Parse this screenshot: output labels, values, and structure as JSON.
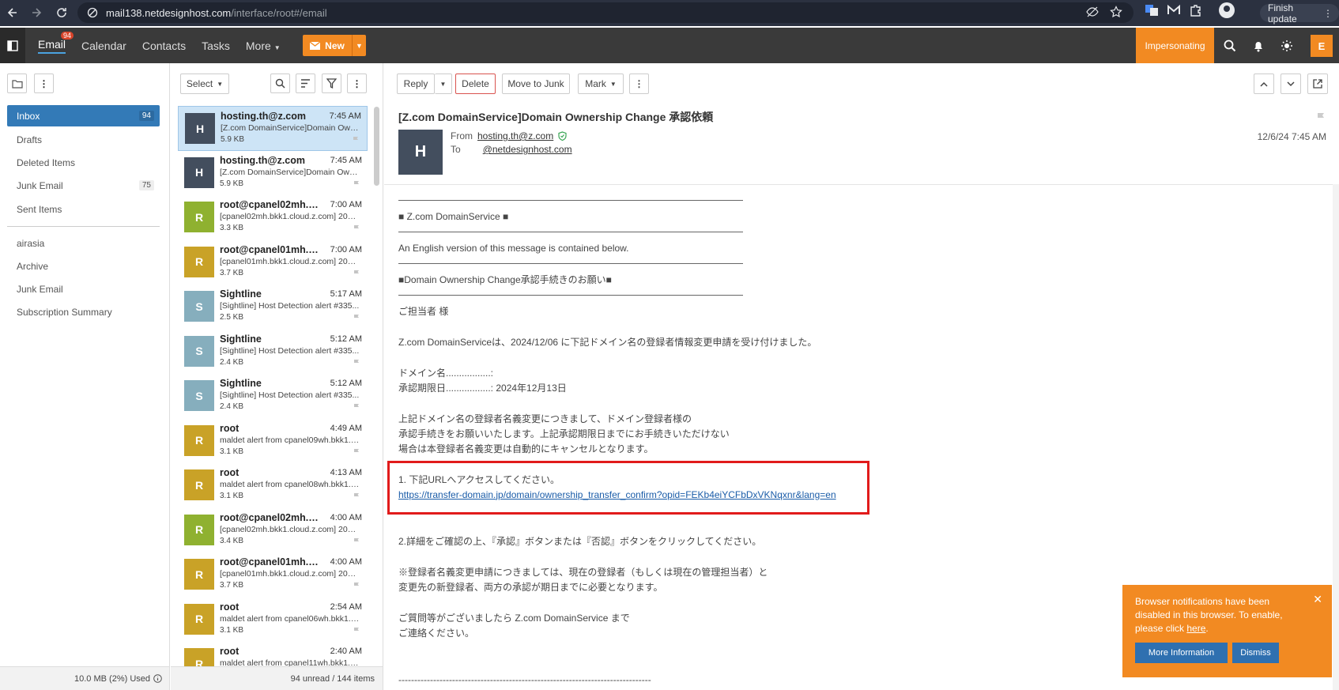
{
  "browser": {
    "url_host": "mail138.netdesignhost.com",
    "url_path": "/interface/root#/email",
    "finish_update": "Finish update"
  },
  "header": {
    "nav": [
      "Email",
      "Calendar",
      "Contacts",
      "Tasks",
      "More"
    ],
    "email_badge": "94",
    "new_label": "New",
    "impersonating": "Impersonating",
    "user_initial": "E"
  },
  "folders": {
    "items": [
      {
        "label": "Inbox",
        "count": "94"
      },
      {
        "label": "Drafts",
        "count": ""
      },
      {
        "label": "Deleted Items",
        "count": ""
      },
      {
        "label": "Junk Email",
        "count": "75"
      },
      {
        "label": "Sent Items",
        "count": ""
      }
    ],
    "extra": [
      "airasia",
      "Archive",
      "Junk Email",
      "Subscription Summary"
    ],
    "storage": "10.0 MB (2%) Used"
  },
  "list": {
    "select_label": "Select",
    "footer": "94 unread / 144 items",
    "messages": [
      {
        "initial": "H",
        "color": "#434e5e",
        "from": "hosting.th@z.com",
        "time": "7:45 AM",
        "subject": "[Z.com DomainService]Domain Own...",
        "size": "5.9 KB"
      },
      {
        "initial": "H",
        "color": "#434e5e",
        "from": "hosting.th@z.com",
        "time": "7:45 AM",
        "subject": "[Z.com DomainService]Domain Own...",
        "size": "5.9 KB"
      },
      {
        "initial": "R",
        "color": "#8fb130",
        "from": "root@cpanel02mh.bk...",
        "time": "7:00 AM",
        "subject": "[cpanel02mh.bkk1.cloud.z.com] 2024...",
        "size": "3.3 KB"
      },
      {
        "initial": "R",
        "color": "#c9a227",
        "from": "root@cpanel01mh.bkk...",
        "time": "7:00 AM",
        "subject": "[cpanel01mh.bkk1.cloud.z.com] 2024...",
        "size": "3.7 KB"
      },
      {
        "initial": "S",
        "color": "#86aebd",
        "from": "Sightline",
        "time": "5:17 AM",
        "subject": "[Sightline] Host Detection alert #335...",
        "size": "2.5 KB"
      },
      {
        "initial": "S",
        "color": "#86aebd",
        "from": "Sightline",
        "time": "5:12 AM",
        "subject": "[Sightline] Host Detection alert #335...",
        "size": "2.4 KB"
      },
      {
        "initial": "S",
        "color": "#86aebd",
        "from": "Sightline",
        "time": "5:12 AM",
        "subject": "[Sightline] Host Detection alert #335...",
        "size": "2.4 KB"
      },
      {
        "initial": "R",
        "color": "#c9a227",
        "from": "root",
        "time": "4:49 AM",
        "subject": "maldet alert from cpanel09wh.bkk1.c...",
        "size": "3.1 KB"
      },
      {
        "initial": "R",
        "color": "#c9a227",
        "from": "root",
        "time": "4:13 AM",
        "subject": "maldet alert from cpanel08wh.bkk1.c...",
        "size": "3.1 KB"
      },
      {
        "initial": "R",
        "color": "#8fb130",
        "from": "root@cpanel02mh.bk...",
        "time": "4:00 AM",
        "subject": "[cpanel02mh.bkk1.cloud.z.com] 2024...",
        "size": "3.4 KB"
      },
      {
        "initial": "R",
        "color": "#c9a227",
        "from": "root@cpanel01mh.bkk...",
        "time": "4:00 AM",
        "subject": "[cpanel01mh.bkk1.cloud.z.com] 2024...",
        "size": "3.7 KB"
      },
      {
        "initial": "R",
        "color": "#c9a227",
        "from": "root",
        "time": "2:54 AM",
        "subject": "maldet alert from cpanel06wh.bkk1.c...",
        "size": "3.1 KB"
      },
      {
        "initial": "R",
        "color": "#c9a227",
        "from": "root",
        "time": "2:40 AM",
        "subject": "maldet alert from cpanel11wh.bkk1.c...",
        "size": ""
      }
    ]
  },
  "reader": {
    "toolbar": {
      "reply": "Reply",
      "delete": "Delete",
      "junk": "Move to Junk",
      "mark": "Mark"
    },
    "subject": "[Z.com DomainService]Domain Ownership Change 承認依頼",
    "avatar_initial": "H",
    "from_label": "From",
    "from": "hosting.th@z.com",
    "to_label": "To",
    "to": "@netdesignhost.com",
    "date": "12/6/24 7:45 AM",
    "body": {
      "service": "■ Z.com DomainService ■",
      "english_note": "An English version of this message is contained below.",
      "request_title": "■Domain Ownership Change承認手続きのお願い■",
      "greeting": "ご担当者 様",
      "intro": "Z.com DomainServiceは、2024/12/06 に下記ドメイン名の登録者情報変更申請を受け付けました。",
      "domain_label": "ドメイン名.................:",
      "deadline": "承認期限日.................: 2024年12月13日",
      "para1_l1": "上記ドメイン名の登録者名義変更につきまして、ドメイン登録者様の",
      "para1_l2": "承認手続きをお願いいたします。上記承認期限日までにお手続きいただけない",
      "para1_l3": "場合は本登録者名義変更は自動的にキャンセルとなります。",
      "step1": "1. 下記URLへアクセスしてください。",
      "url": "https://transfer-domain.jp/domain/ownership_transfer_confirm?opid=FEKb4eiYCFbDxVKNqxnr&lang=en",
      "step2": "2.詳細をご確認の上、『承認』ボタンまたは『否認』ボタンをクリックしてください。",
      "note_l1": "※登録者名義変更申請につきましては、現在の登録者（もしくは現在の管理担当者）と",
      "note_l2": "変更先の新登録者、両方の承認が期日までに必要となります。",
      "contact_l1": "ご質問等がございましたら Z.com DomainService まで",
      "contact_l2": "ご連絡ください。",
      "dashes": "--------------------------------------------------------------------------------"
    }
  },
  "toast": {
    "text": "Browser notifications have been disabled in this browser. To enable, please click",
    "link": "here",
    "more_info": "More Information",
    "dismiss": "Dismiss"
  }
}
